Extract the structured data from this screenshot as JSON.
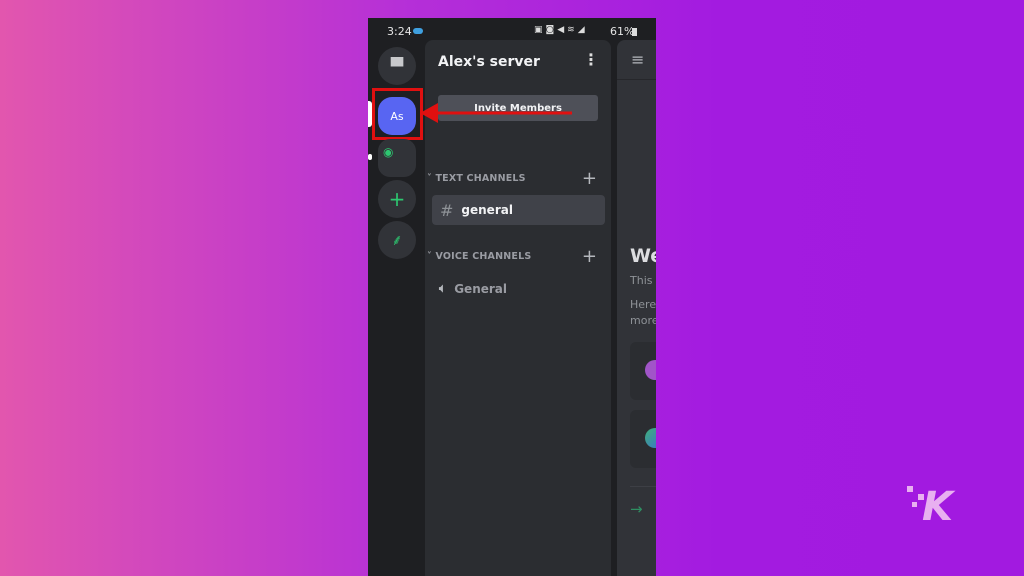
{
  "status_bar": {
    "time": "3:24",
    "battery": "61%"
  },
  "server": {
    "name": "Alex's server",
    "icon_label": "As",
    "accent": "#5865f2"
  },
  "invite_button": "Invite Members",
  "categories": [
    {
      "label": "TEXT CHANNELS",
      "channels": [
        {
          "name": "general",
          "type": "text",
          "selected": true
        }
      ]
    },
    {
      "label": "VOICE CHANNELS",
      "channels": [
        {
          "name": "General",
          "type": "voice",
          "selected": false
        }
      ]
    }
  ],
  "right_panel": {
    "welcome": "We",
    "line1": "This",
    "line2a": "Here",
    "line2b": "more"
  },
  "annotation": {
    "color": "#e01010"
  },
  "watermark": "K"
}
